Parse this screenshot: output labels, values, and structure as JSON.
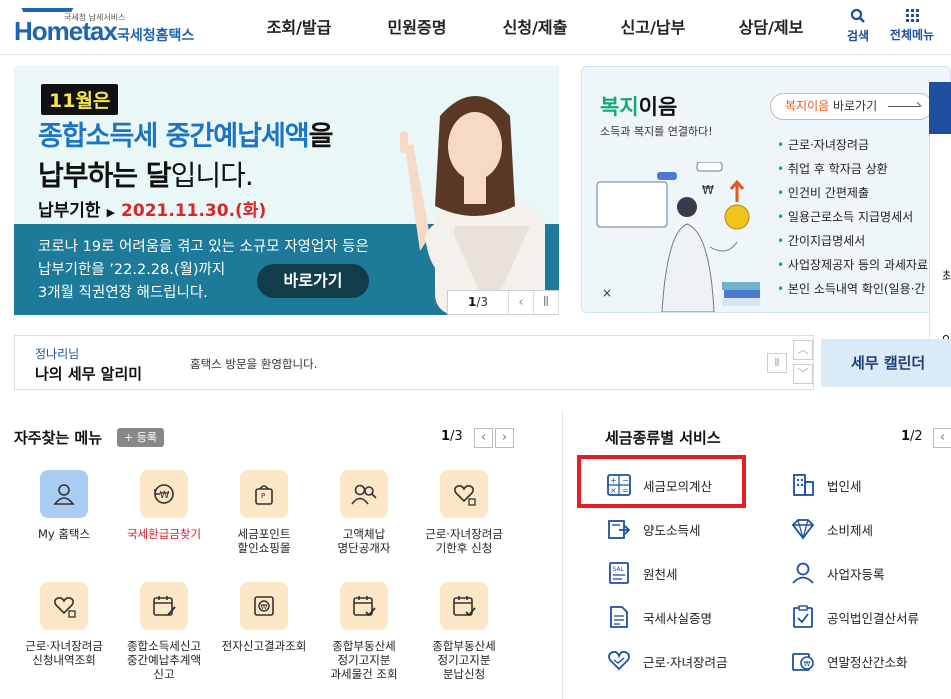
{
  "header": {
    "logo_text": "Hometax",
    "logo_small": "국세청 납세서비스",
    "logo_kr": "국세청홈택스",
    "nav": [
      "조회/발급",
      "민원증명",
      "신청/제출",
      "신고/납부",
      "상담/제보"
    ],
    "search_label": "검색",
    "all_menu_label": "전체메뉴"
  },
  "banner": {
    "badge": "11월은",
    "line1_blue": "종합소득세 중간예납세액",
    "line1_black": "을",
    "line2_bold": "납부하는 달",
    "line2_light": "입니다.",
    "due_label": "납부기한",
    "due_date": "2021.11.30.(화)",
    "note_lines": [
      "코로나 19로 어려움을 겪고 있는 소규모 자영업자 등은",
      "납부기한을 ’22.2.28.(월)까지",
      "3개월 직권연장 해드립니다."
    ],
    "go_button": "바로가기",
    "page_current": "1",
    "page_total": "/3"
  },
  "side_banner": {
    "title_green": "복지",
    "title_black": "이음",
    "subtitle": "소득과 복지를 연결하다!",
    "go_label_green": "복지이음",
    "go_label": " 바로가기",
    "items": [
      "근로·자녀장려금",
      "취업 후 학자금 상환",
      "인건비 간편제출",
      "일용근로소득 지급명세서",
      "간이지급명세서",
      "사업장제공자 등의 과세자료",
      "본인 소득내역 확인(일용·간"
    ]
  },
  "right_panel_chars": [
    "최",
    "인"
  ],
  "notice": {
    "name": "정나리님",
    "title": "나의 세무 알리미",
    "message": "홈택스 방문을 환영합니다.",
    "calendar_button": "세무 캘린더"
  },
  "favorites": {
    "title": "자주찾는 메뉴",
    "register": "+ 등록",
    "page_current": "1",
    "page_total": "/3",
    "items": [
      {
        "label": "My 홈택스",
        "icon": "person-icon"
      },
      {
        "label": "국세환급금찾기",
        "icon": "refund-icon"
      },
      {
        "label": "세금포인트\n할인쇼핑몰",
        "icon": "tax-bag-icon"
      },
      {
        "label": "고액체납\n명단공개자",
        "icon": "people-search-icon"
      },
      {
        "label": "근로·자녀장려금\n기한후 신청",
        "icon": "heart-hand-icon"
      },
      {
        "label": "근로·자녀장려금\n신청내역조회",
        "icon": "heart-hand-icon"
      },
      {
        "label": "종합소득세신고\n중간예납추계액\n신고",
        "icon": "calendar-pen-icon"
      },
      {
        "label": "전자신고결과조회",
        "icon": "won-doc-icon"
      },
      {
        "label": "종합부동산세\n정기고지분\n과세물건 조회",
        "icon": "calendar-check-icon"
      },
      {
        "label": "종합부동산세\n정기고지분\n분납신청",
        "icon": "calendar-check-icon"
      }
    ]
  },
  "tax_services": {
    "title": "세금종류별 서비스",
    "page_current": "1",
    "page_total": "/2",
    "items": [
      {
        "label": "세금모의계산",
        "icon": "calculator-icon"
      },
      {
        "label": "법인세",
        "icon": "building-icon"
      },
      {
        "label": "양도소득세",
        "icon": "transfer-doc-icon"
      },
      {
        "label": "소비제세",
        "icon": "diamond-icon"
      },
      {
        "label": "원천세",
        "icon": "salary-doc-icon"
      },
      {
        "label": "사업자등록",
        "icon": "person-icon"
      },
      {
        "label": "국세사실증명",
        "icon": "document-icon"
      },
      {
        "label": "공익법인결산서류",
        "icon": "checklist-icon"
      },
      {
        "label": "근로·자녀장려금",
        "icon": "heart-hand-icon"
      },
      {
        "label": "연말정산간소화",
        "icon": "won-box-icon"
      }
    ]
  },
  "colors": {
    "brand_blue": "#1e4fa1",
    "highlight_red": "#e51d24",
    "banner_teal": "#1d7a99"
  }
}
